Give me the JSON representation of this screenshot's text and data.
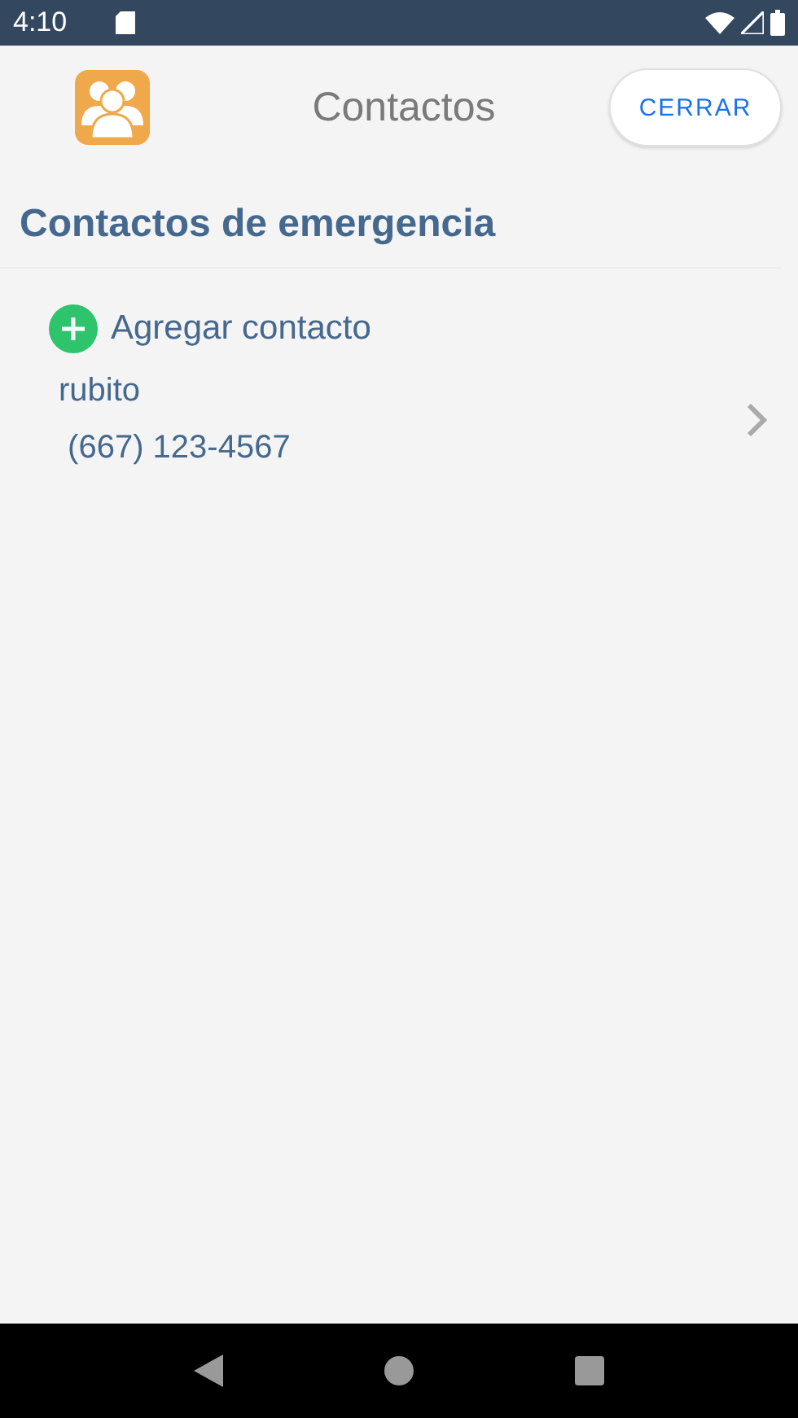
{
  "status_bar": {
    "time": "4:10"
  },
  "header": {
    "title": "Contactos",
    "close_button": "CERRAR"
  },
  "section": {
    "title": "Contactos de emergencia",
    "add_button": "Agregar contacto"
  },
  "contacts": [
    {
      "name": "rubito",
      "phone": " (667) 123-4567"
    }
  ]
}
